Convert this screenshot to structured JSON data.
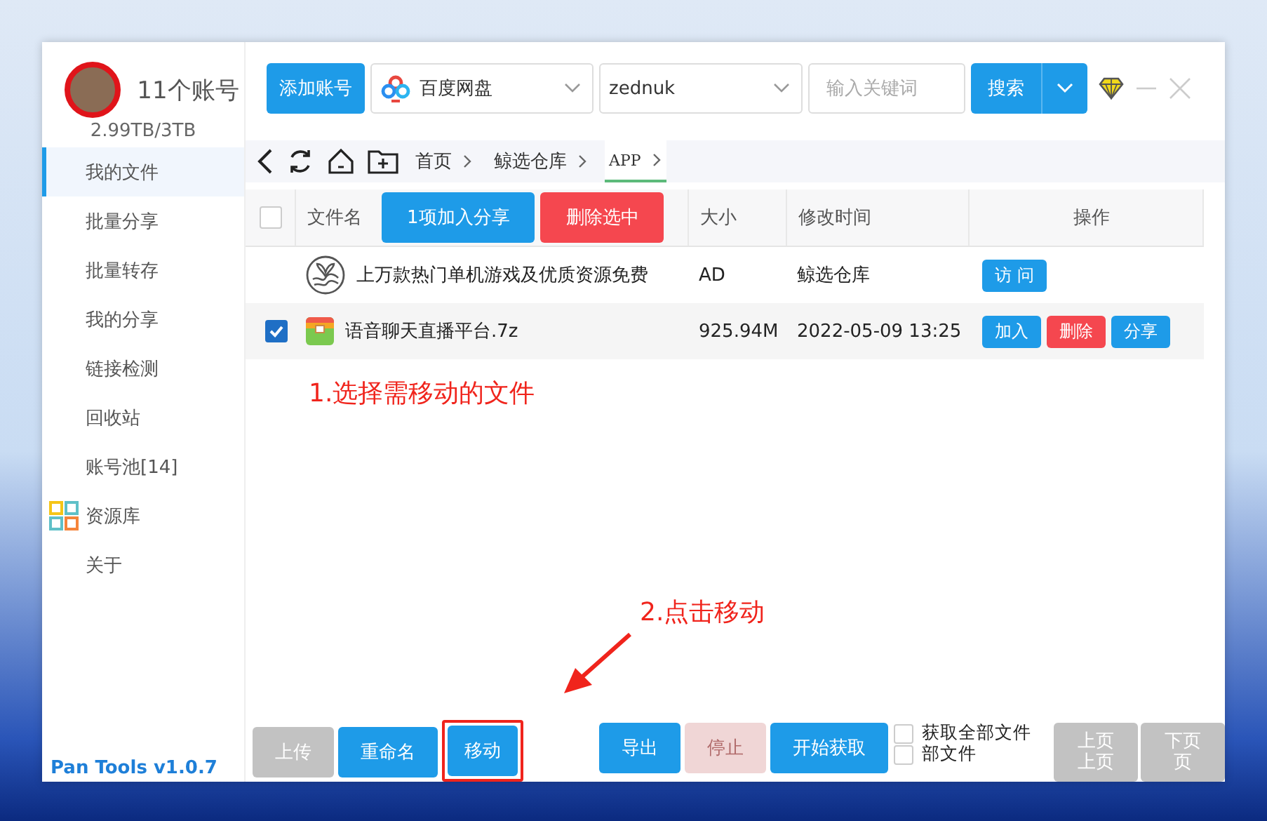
{
  "header": {
    "account_count": "11个账号",
    "storage": "2.99TB/3TB",
    "add_button": "添加账号",
    "drive_select": "百度网盘",
    "user_select": "zednuk",
    "search": {
      "placeholder": "输入关键词"
    },
    "search_button": "搜索"
  },
  "sidebar": {
    "items": [
      {
        "label": "我的文件",
        "selected": true,
        "kind": "plain"
      },
      {
        "label": "批量分享",
        "selected": false,
        "kind": "plain"
      },
      {
        "label": "批量转存",
        "selected": false,
        "kind": "plain"
      },
      {
        "label": "我的分享",
        "selected": false,
        "kind": "plain"
      },
      {
        "label": "链接检测",
        "selected": false,
        "kind": "plain"
      },
      {
        "label": "回收站",
        "selected": false,
        "kind": "plain"
      },
      {
        "label": "账号池[14]",
        "selected": false,
        "kind": "plain"
      },
      {
        "label": "资源库",
        "selected": false,
        "kind": "icon"
      },
      {
        "label": "关于",
        "selected": false,
        "kind": "plain"
      }
    ],
    "footer_title": "Pan Tools v1.0.7"
  },
  "breadcrumb": [
    {
      "label": "首页",
      "selected": false
    },
    {
      "label": "鲸选仓库",
      "selected": false
    },
    {
      "label": "APP",
      "selected": true
    }
  ],
  "table": {
    "select_all": false,
    "columns": [
      "文件名",
      "大小",
      "修改时间",
      "操作"
    ],
    "header_buttons": [
      {
        "label": "1项加入分享",
        "kind": "primary"
      },
      {
        "label": "删除选中",
        "kind": "danger"
      }
    ],
    "rows": [
      {
        "kind": "ad",
        "name": "上万款热门单机游戏及优质资源免费",
        "size": "AD",
        "modified": "鲸选仓库",
        "actions": [
          {
            "label": "访 问",
            "kind": "primary"
          }
        ]
      },
      {
        "kind": "file",
        "checked": true,
        "name": "语音聊天直播平台.7z",
        "size": "925.94M",
        "modified": "2022-05-09 13:25",
        "actions": [
          {
            "label": "加入",
            "kind": "primary"
          },
          {
            "label": "删除",
            "kind": "danger"
          },
          {
            "label": "分享",
            "kind": "primary"
          }
        ]
      }
    ]
  },
  "annotations": [
    {
      "text": "1.选择需移动的文件"
    },
    {
      "text": "2.点击移动"
    }
  ],
  "bottom": {
    "groups": [
      [
        {
          "label": "上传",
          "kind": "primary",
          "disabled": true,
          "highlighted": false
        },
        {
          "label": "重命名",
          "kind": "primary",
          "disabled": false,
          "highlighted": false
        },
        {
          "label": "移动",
          "kind": "primary",
          "disabled": false,
          "highlighted": true
        }
      ],
      [
        {
          "label": "导出",
          "kind": "primary",
          "disabled": false,
          "highlighted": false
        },
        {
          "label": "停止",
          "kind": "danger",
          "disabled": true,
          "highlighted": false
        },
        {
          "label": "开始获取",
          "kind": "primary",
          "disabled": false,
          "highlighted": false
        }
      ]
    ],
    "checkboxes": [
      {
        "label": "获取全部文件",
        "checked": false
      },
      {
        "label": "部文件",
        "checked": false
      }
    ],
    "pager": [
      {
        "lines": [
          "上页",
          "上页"
        ],
        "disabled": true
      },
      {
        "lines": [
          "下页",
          "页"
        ],
        "disabled": true
      }
    ]
  }
}
